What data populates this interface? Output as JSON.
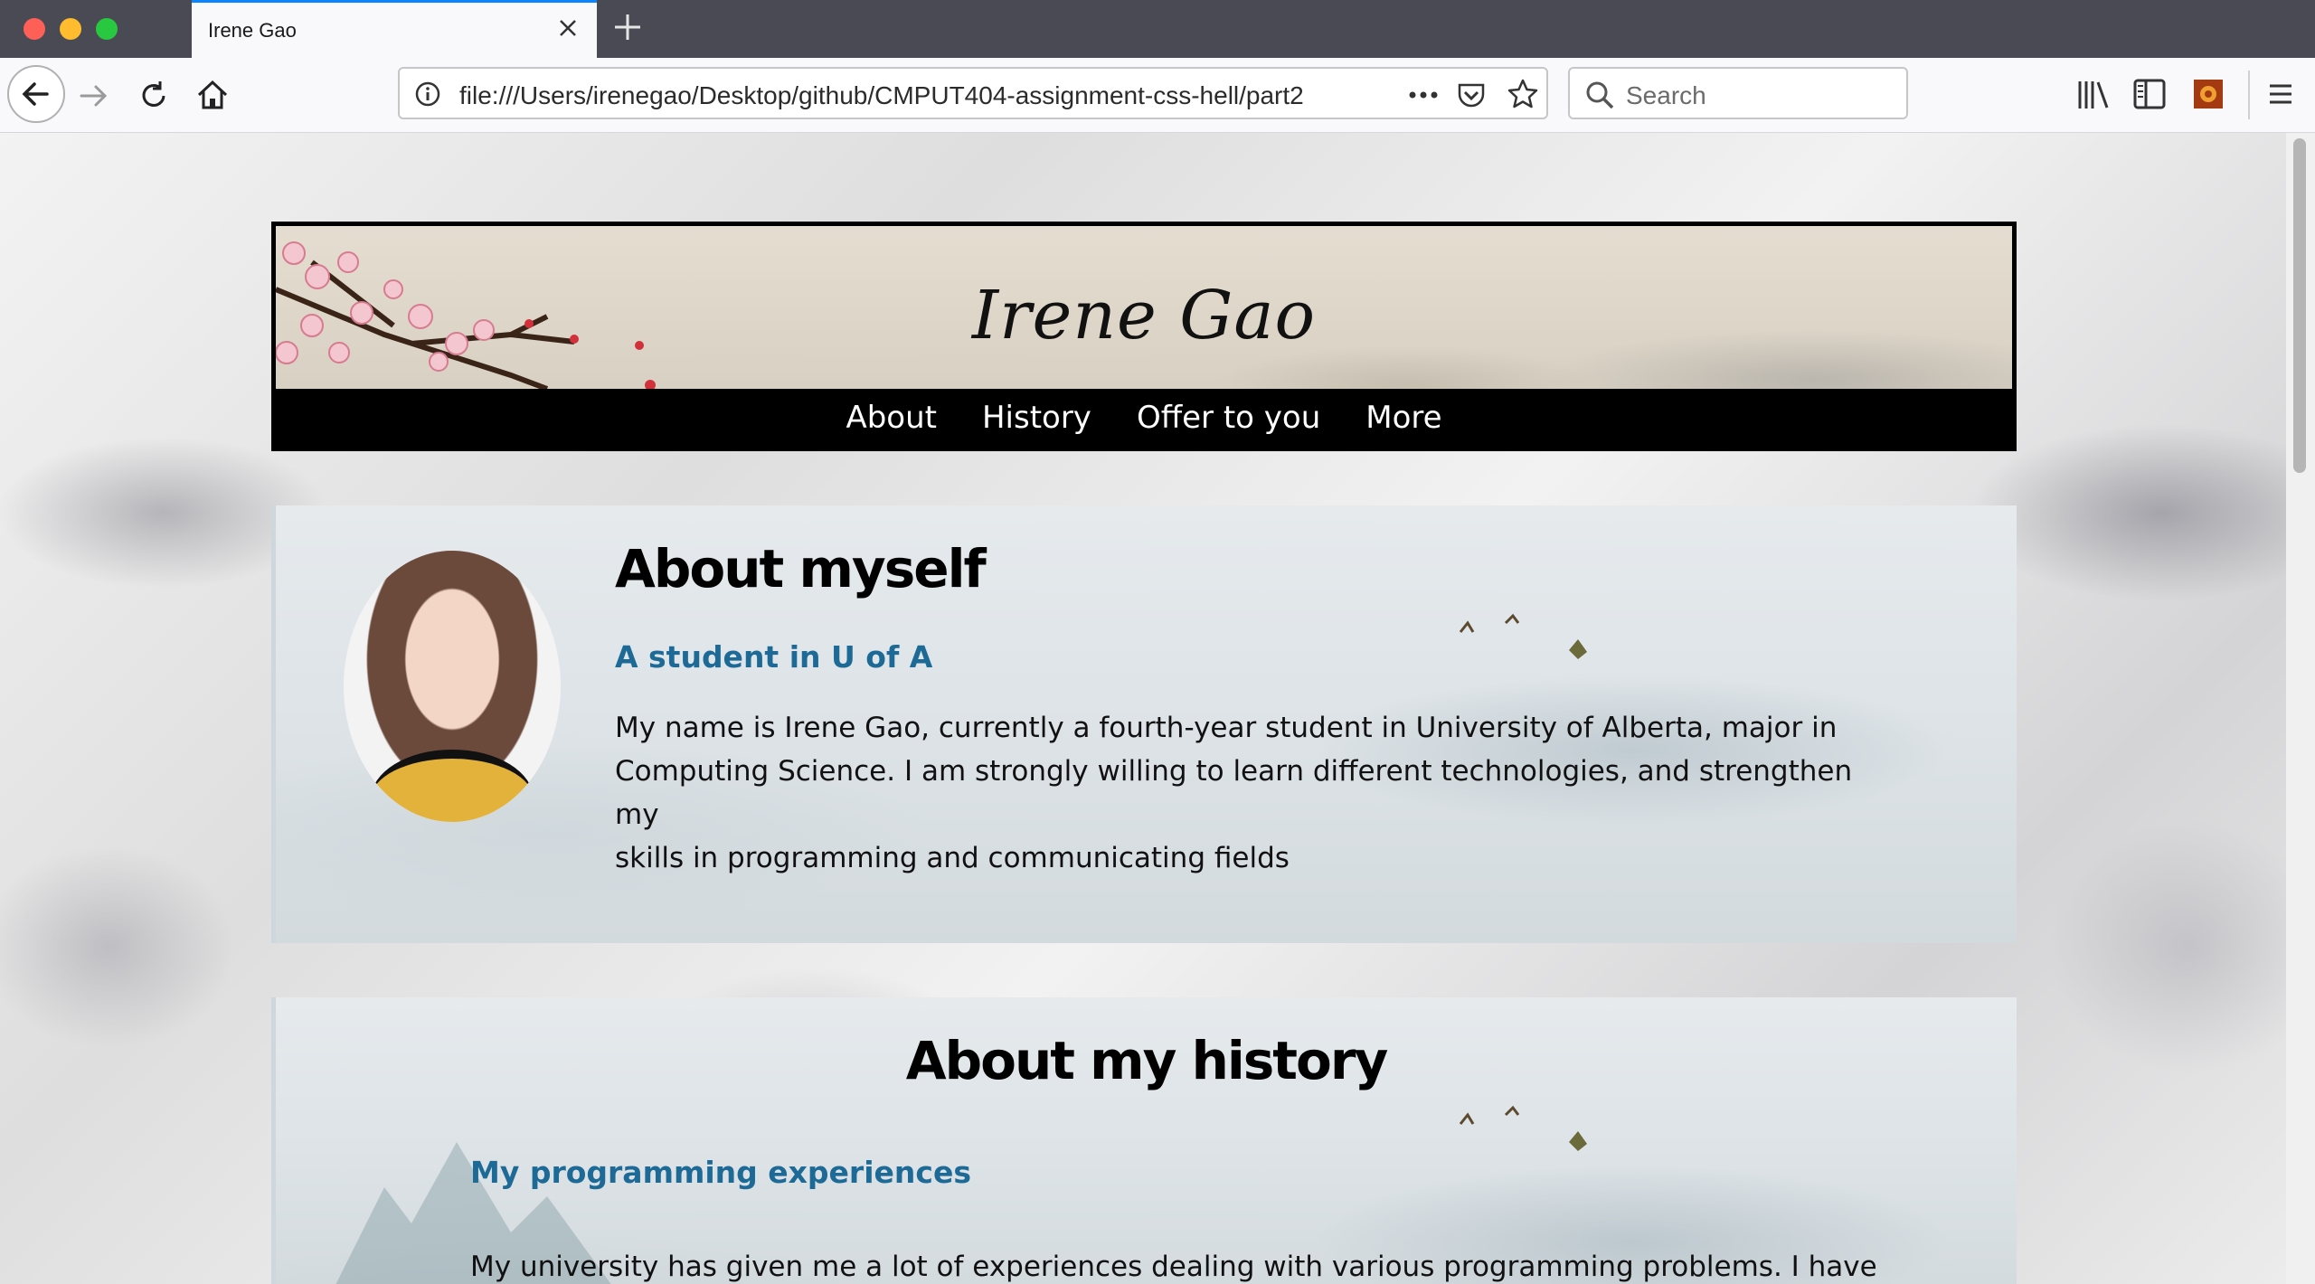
{
  "browser": {
    "tab_title": "Irene Gao",
    "url": "file:///Users/irenegao/Desktop/github/CMPUT404-assignment-css-hell/part2",
    "search_placeholder": "Search"
  },
  "header": {
    "site_title": "Irene Gao",
    "nav": [
      {
        "label": "About"
      },
      {
        "label": "History"
      },
      {
        "label": "Offer to you"
      },
      {
        "label": "More"
      }
    ]
  },
  "about": {
    "title": "About myself",
    "subtitle": "A student in U of A",
    "paragraph_lines": [
      "My name is Irene Gao, currently a fourth-year student in University of Alberta, major in",
      "Computing Science. I am strongly willing to learn different technologies, and strengthen my",
      "skills in programming and communicating fields"
    ]
  },
  "history": {
    "title": "About my history",
    "subtitle": "My programming experiences",
    "paragraph_lines": [
      "My university has given me a lot of experiences dealing with various programming problems. I have"
    ]
  },
  "colors": {
    "accent_tab": "#0a84ff",
    "subtitle_blue": "#1e6a96",
    "nav_background": "#000000"
  }
}
